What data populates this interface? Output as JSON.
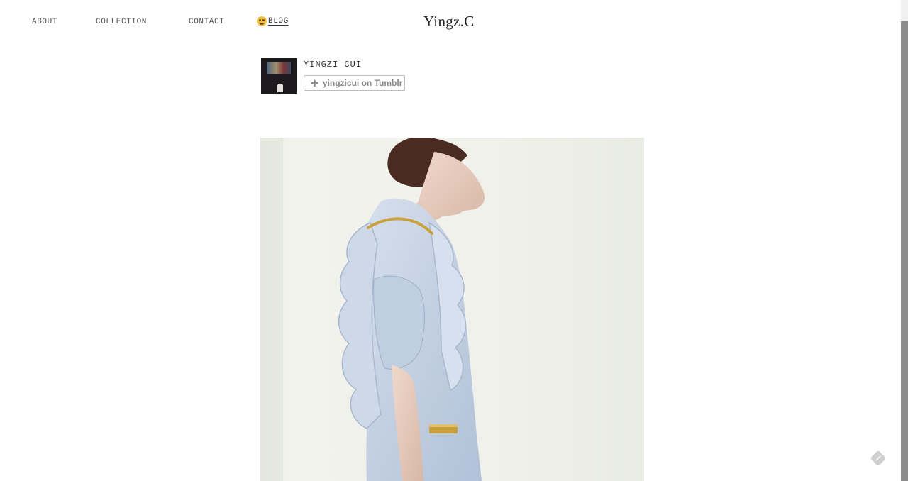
{
  "nav": {
    "about": "ABOUT",
    "collection": "COLLECTION",
    "contact": "CONTACT",
    "blog": "BLOG",
    "blog_icon": "smiley-emoji-icon"
  },
  "site": {
    "title": "Yingz.C"
  },
  "profile": {
    "name": "YINGZI CUI",
    "follow_label": "yingzicui on Tumblr",
    "follow_icon": "plus-icon"
  },
  "post": {
    "image_icon": "fashion-photo"
  },
  "colors": {
    "background": "#ffffff",
    "text": "#333333",
    "button_border": "#bdbdbd",
    "button_text": "#8a8a8a",
    "scrollbar_thumb": "#8c8c8c"
  },
  "corner": {
    "icon": "tumblr-dashboard-icon"
  }
}
